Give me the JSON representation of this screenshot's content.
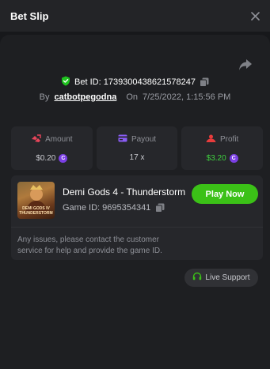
{
  "header": {
    "title": "Bet Slip"
  },
  "bet": {
    "id_label": "Bet ID: 1739300438621578247",
    "by_label": "By",
    "username": "catbotpegodna",
    "on_label": "On",
    "datetime": "7/25/2022, 1:15:56 PM"
  },
  "stats": {
    "amount": {
      "label": "Amount",
      "value": "$0.20",
      "icon": "amount-icon",
      "color": "#e8455a"
    },
    "payout": {
      "label": "Payout",
      "value": "17 x",
      "icon": "card-icon",
      "color": "#8a5cf5"
    },
    "profit": {
      "label": "Profit",
      "value": "$3.20",
      "icon": "profit-icon",
      "color": "#e83c3c",
      "value_color": "#3fcf3f"
    },
    "currency_glyph": "C"
  },
  "game": {
    "title": "Demi Gods 4 - Thunderstorm",
    "id_label": "Game ID: 9695354341",
    "thumb_text": "DEMI GODS IV THUNDERSTORM",
    "play_label": "Play Now"
  },
  "support": {
    "text": "Any issues, please contact the customer service for help and provide the game ID.",
    "button_label": "Live Support"
  },
  "colors": {
    "accent_green": "#3bc117",
    "shield_green": "#1fc31f",
    "coin_purple": "#7b3fe4"
  }
}
